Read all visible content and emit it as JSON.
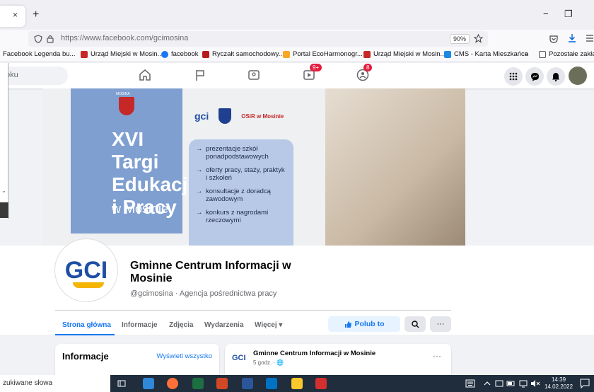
{
  "browser": {
    "tab_close": "×",
    "new_tab": "+",
    "minimize": "−",
    "restore": "❐",
    "url": "https://www.facebook.com/gcimosina",
    "zoom": "90%"
  },
  "bookmarks": [
    {
      "label": "Facebook Legenda bu...",
      "color": "#1877f2"
    },
    {
      "label": "Urząd Miejski w Mosin...",
      "color": "#c62828"
    },
    {
      "label": "facebook",
      "color": "#1877f2"
    },
    {
      "label": "Ryczałt samochodowy...",
      "color": "#b71c1c"
    },
    {
      "label": "Portal EcoHarmonogr...",
      "color": "#f9a825"
    },
    {
      "label": "Urząd Miejski w Mosin...",
      "color": "#c62828"
    },
    {
      "label": "CMS - Karta Mieszkańca",
      "color": "#1e88e5"
    },
    {
      "label": "Pozostałe zakładki",
      "color": "#555555"
    }
  ],
  "bookmarks_overflow": "»",
  "fb": {
    "search_placeholder": "oku",
    "watch_badge": "9+",
    "groups_badge": "8"
  },
  "cover": {
    "crest_label": "MOSINA",
    "title_line1": "XVI Targi",
    "title_line2": "Edukacji",
    "title_line3": "i Pracy",
    "title_place": "w Mosinie",
    "logo_gci": "gci",
    "logo_osir": "OSiR w Mosinie",
    "items": [
      "prezentacje szkół ponadpodstawowych",
      "oferty pracy, staży, praktyk i szkoleń",
      "konsultacje z doradcą zawodowym",
      "konkurs z nagrodami rzeczowymi"
    ]
  },
  "page": {
    "logo": "GCI",
    "name": "Gminne Centrum Informacji w Mosinie",
    "handle": "@gcimosina · Agencja pośrednictwa pracy",
    "tabs": [
      "Strona główna",
      "Informacje",
      "Zdjęcia",
      "Wydarzenia",
      "Więcej ▾"
    ],
    "like_label": "Polub to",
    "more": "···"
  },
  "info_card": {
    "title": "Informacje",
    "link": "Wyświetl wszystko"
  },
  "post": {
    "logo": "GCI",
    "author": "Gminne Centrum Informacji w Mosinie",
    "time": "5 godz. · 🌐",
    "more": "···"
  },
  "taskbar": {
    "search_text": "zukiwane słowa",
    "time": "14:39",
    "date": "14.02.2022"
  }
}
